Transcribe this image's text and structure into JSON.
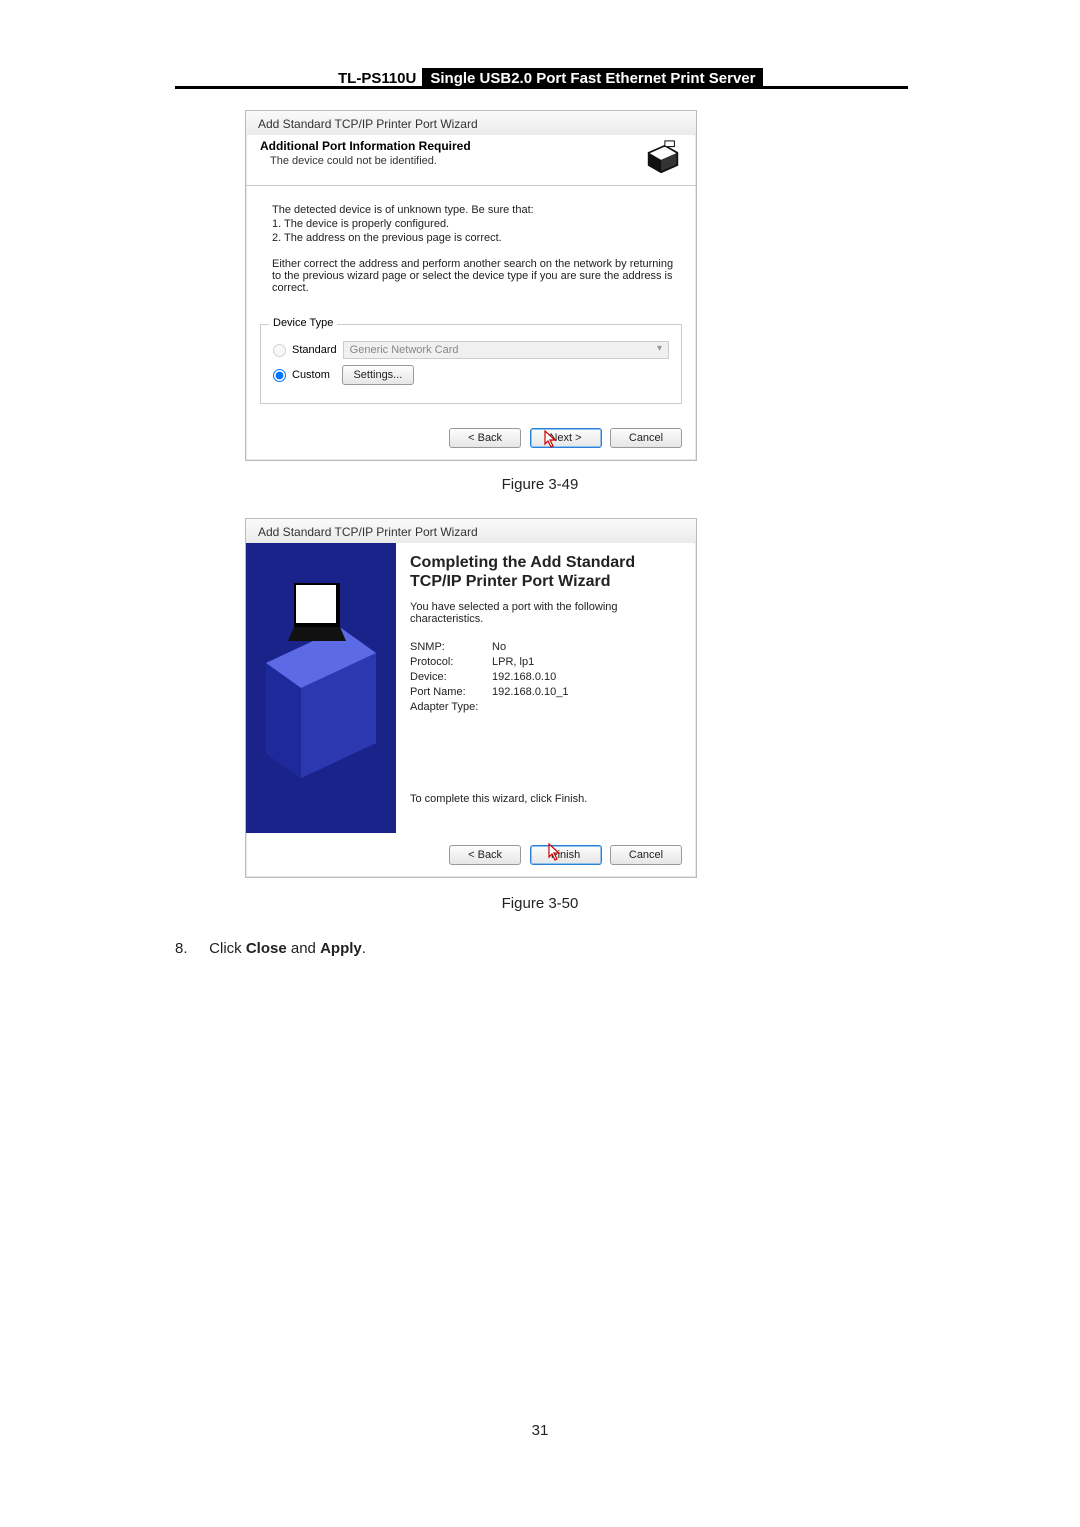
{
  "header": {
    "model": "TL-PS110U",
    "product": "Single USB2.0 Port Fast Ethernet Print Server"
  },
  "dialog1": {
    "window_title": "Add Standard TCP/IP Printer Port Wizard",
    "head_title": "Additional Port Information Required",
    "head_sub": "The device could not be identified.",
    "body_line1": "The detected device is of unknown type.  Be sure that:",
    "body_line2": "1.  The device is properly configured.",
    "body_line3": "2.  The address on the previous page is correct.",
    "body_para2": "Either correct the address and perform another search on the network by returning to the previous wizard page or select the device type if you are sure the address is correct.",
    "group_title": "Device Type",
    "opt_standard": "Standard",
    "dd_value": "Generic Network Card",
    "opt_custom": "Custom",
    "btn_settings": "Settings...",
    "btn_back": "< Back",
    "btn_next": "Next >",
    "btn_cancel": "Cancel"
  },
  "fig1_label": "Figure 3-49",
  "dialog2": {
    "window_title": "Add Standard TCP/IP Printer Port Wizard",
    "title_line1": "Completing the Add Standard",
    "title_line2": "TCP/IP Printer Port Wizard",
    "desc": "You have selected a port with the following characteristics.",
    "kv": {
      "snmp_k": "SNMP:",
      "snmp_v": "No",
      "proto_k": "Protocol:",
      "proto_v": "LPR, lp1",
      "dev_k": "Device:",
      "dev_v": "192.168.0.10",
      "port_k": "Port Name:",
      "port_v": "192.168.0.10_1",
      "adapt_k": "Adapter Type:",
      "adapt_v": ""
    },
    "finish_text": "To complete this wizard, click Finish.",
    "btn_back": "< Back",
    "btn_finish": "Finish",
    "btn_cancel": "Cancel"
  },
  "fig2_label": "Figure 3-50",
  "step": {
    "num": "8.",
    "text_a": "Click ",
    "text_close": "Close",
    "text_b": " and ",
    "text_apply": "Apply",
    "text_c": "."
  },
  "page_number": "31"
}
